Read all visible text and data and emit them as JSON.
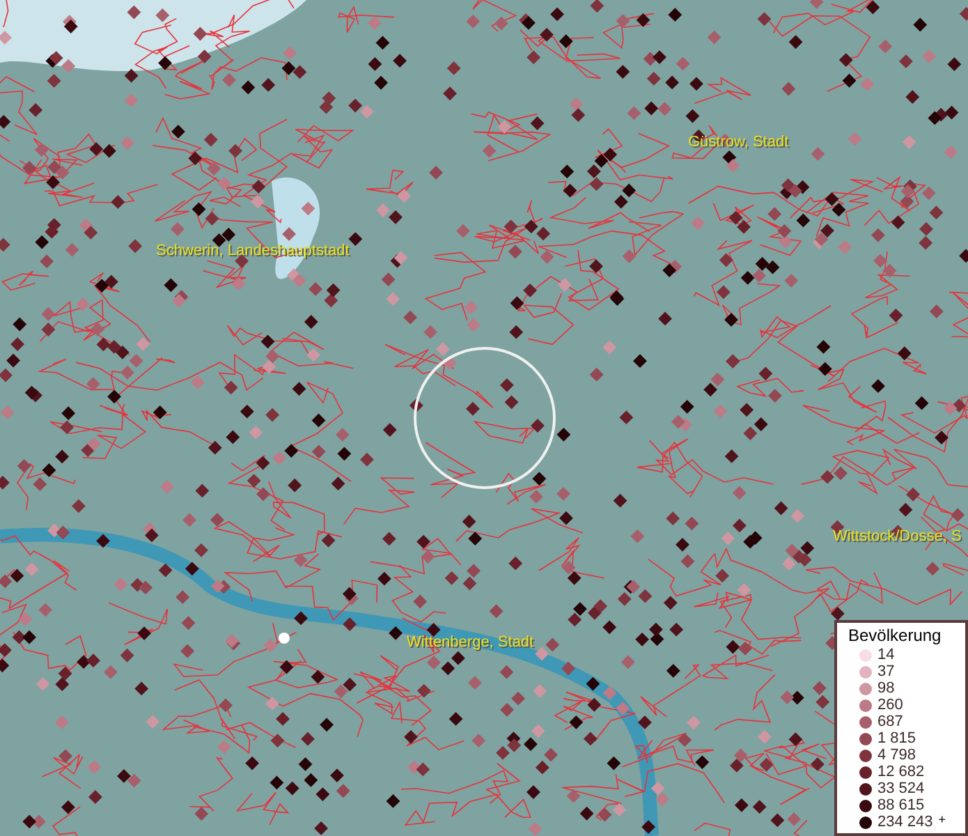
{
  "map": {
    "places": [
      {
        "name": "Güstrow, Stadt"
      },
      {
        "name": "Schwerin, Landeshauptstadt"
      },
      {
        "name": "Wittstock/Dosse, S"
      },
      {
        "name": "Wittenberge, Stadt"
      }
    ]
  },
  "legend": {
    "title": "Bevölkerung",
    "items": [
      {
        "label": "14",
        "color": "#f6dde6"
      },
      {
        "label": "37",
        "color": "#e2b4c0"
      },
      {
        "label": "98",
        "color": "#cf97a2"
      },
      {
        "label": "260",
        "color": "#bc7b86"
      },
      {
        "label": "687",
        "color": "#a7606b"
      },
      {
        "label": "1 815",
        "color": "#934853"
      },
      {
        "label": "4 798",
        "color": "#7e333d"
      },
      {
        "label": "12 682",
        "color": "#68212b"
      },
      {
        "label": "33 524",
        "color": "#51141c"
      },
      {
        "label": "88 615",
        "color": "#3b0a10"
      },
      {
        "label": "234 243",
        "color": "#240407",
        "more": "+"
      }
    ]
  }
}
